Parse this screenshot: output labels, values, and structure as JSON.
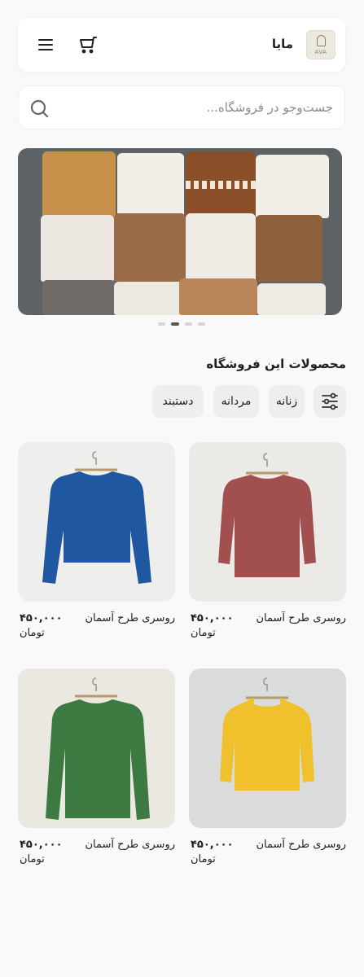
{
  "header": {
    "logo_text": "AVA",
    "brand": "مایا",
    "cart_icon": "cart-icon",
    "menu_icon": "menu-icon"
  },
  "search": {
    "placeholder": "جست‌وجو در فروشگاه...",
    "icon": "search-icon"
  },
  "banner": {
    "slides": 4,
    "active_slide": 2
  },
  "products_section": {
    "title": "محصولات این فروشگاه",
    "filter_icon": "sliders-icon",
    "chips": [
      "زنانه",
      "مردانه",
      "دستبند"
    ]
  },
  "products": [
    {
      "name": "روسری طرح آسمان",
      "price": "۴۵۰,۰۰۰",
      "currency": "تومان",
      "color": "#a24f4f",
      "bg": "#eceae7"
    },
    {
      "name": "روسری طرح آسمان",
      "price": "۴۵۰,۰۰۰",
      "currency": "تومان",
      "color": "#1f57a0",
      "bg": "#eeeeec"
    },
    {
      "name": "روسری طرح آسمان",
      "price": "۴۵۰,۰۰۰",
      "currency": "تومان",
      "color": "#f0c12c",
      "bg": "#dadbdb"
    },
    {
      "name": "روسری طرح آسمان",
      "price": "۴۵۰,۰۰۰",
      "currency": "تومان",
      "color": "#3d7a41",
      "bg": "#ebe8e2"
    }
  ]
}
